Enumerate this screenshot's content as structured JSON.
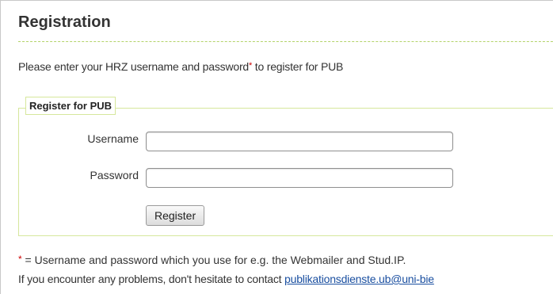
{
  "page": {
    "title": "Registration",
    "intro_before": "Please enter your HRZ username and password",
    "required_marker": "*",
    "intro_after": " to register for PUB"
  },
  "form": {
    "legend": "Register for PUB",
    "username_label": "Username",
    "username_value": "",
    "password_label": "Password",
    "password_value": "",
    "submit_label": "Register"
  },
  "footer": {
    "note_marker": "*",
    "note_text": " = Username and password which you use for e.g. the Webmailer and Stud.IP.",
    "contact_text": "If you encounter any problems, don't hesitate to contact ",
    "contact_link": "publikationsdienste.ub@uni-bie"
  },
  "colors": {
    "accent_rule": "#b3d36a",
    "fieldset_border": "#d6e79c",
    "required": "#cc0000",
    "link": "#1a4fa0"
  }
}
